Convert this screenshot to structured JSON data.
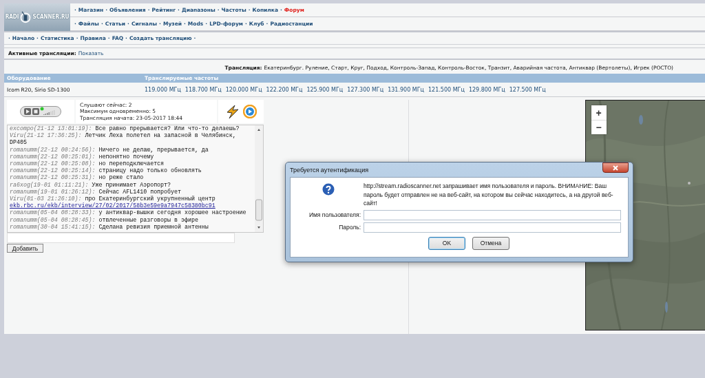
{
  "logo": {
    "left": "RADI",
    "right": "SCANNER.RU"
  },
  "separator": "·",
  "menu_rows": [
    [
      {
        "label": "Магазин",
        "color": "#1f4e79"
      },
      {
        "label": "Объявления",
        "color": "#1f4e79"
      },
      {
        "label": "Рейтинг",
        "color": "#1f4e79"
      },
      {
        "label": "Диапазоны",
        "color": "#1f4e79"
      },
      {
        "label": "Частоты",
        "color": "#1f4e79"
      },
      {
        "label": "Копилка",
        "color": "#1f4e79"
      },
      {
        "label": "Форум",
        "color": "#e0201b"
      }
    ],
    [
      {
        "label": "Файлы",
        "color": "#1f4e79"
      },
      {
        "label": "Статьи",
        "color": "#1f4e79"
      },
      {
        "label": "Сигналы",
        "color": "#1f4e79"
      },
      {
        "label": "Музей",
        "color": "#1f4e79"
      },
      {
        "label": "Mods",
        "color": "#1f4e79"
      },
      {
        "label": "LPD-форум",
        "color": "#1f4e79"
      },
      {
        "label": "Клуб",
        "color": "#1f4e79"
      },
      {
        "label": "Радиостанции",
        "color": "#1f4e79"
      }
    ]
  ],
  "sub_nav": [
    "Начало",
    "Статистика",
    "Правила",
    "FAQ",
    "Создать трансляцию"
  ],
  "active_streams": {
    "label": "Активные трансляции:",
    "link": "Показать"
  },
  "stream": {
    "label": "Трансляция:",
    "value": "Екатеринбург. Руление, Старт, Круг, Подход, Контроль-Запад, Контроль-Восток, Транзит, Аварийная частота, Антиквар (Вертолеты), Игрек (РОСТО)"
  },
  "table": {
    "columns": [
      "Оборудование",
      "Транслируемые частоты"
    ],
    "rows": [
      {
        "equipment": "Icom R20, Sirio SD-1300",
        "frequencies": [
          "119.000 МГц",
          "118.700 МГц",
          "120.000 МГц",
          "122.200 МГц",
          "125.900 МГц",
          "127.300 МГц",
          "131.900 МГц",
          "121.500 МГц",
          "129.800 МГц",
          "127.500 МГц"
        ]
      }
    ]
  },
  "stats": [
    "Слушают сейчас: 2",
    "Максимум одновременно: 5",
    "Трансляция начата: 23-05-2017 18:44"
  ],
  "chat": {
    "messages": [
      {
        "author": "excompo(21-12 13:01:19):",
        "text": "Все равно прерывается? Или что-то делаешь?"
      },
      {
        "author": "Viru(21-12 17:36:25):",
        "text": "Летчик Леха полетел на запасной в Челябинск, DP405"
      },
      {
        "author": "romanumm(22-12 00:24:56):",
        "text": "Ничего не делаю, прерывается, да"
      },
      {
        "author": "romanumm(22-12 00:25:01):",
        "text": "непонятно почему"
      },
      {
        "author": "romanumm(22-12 00:25:08):",
        "text": "но переподключается"
      },
      {
        "author": "romanumm(22-12 00:25:14):",
        "text": "страницу надо только обновлять"
      },
      {
        "author": "romanumm(22-12 00:25:31):",
        "text": "но реже стало"
      },
      {
        "author": "ra6xog(19-01 01:11:21):",
        "text": "Уже принимает Аэропорт?"
      },
      {
        "author": "romanumm(19-01 01:26:12):",
        "text": "Сейчас AFL1410 попробует"
      },
      {
        "author": "Viru(01-03 21:26:10):",
        "text": "про Екатеринбургский укрупненный центр",
        "link": "ekb.rbc.ru/ekb/interview/27/02/2017/58b3e59e9a7947c58380bc91"
      },
      {
        "author": "romanumm(05-04 08:28:33):",
        "text": "у антиквар-вышки сегодня хорошее настроение"
      },
      {
        "author": "romanumm(05-04 08:28:45):",
        "text": "отвлеченные разговоры в эфире"
      },
      {
        "author": "romanumm(30-04 15:41:15):",
        "text": "Сделана ревизия приемной антенны"
      }
    ],
    "add_button": "Добавить"
  },
  "map": {
    "zoom_in": "+",
    "zoom_out": "−"
  },
  "dialog": {
    "title": "Требуется аутентификация",
    "message": "http://stream.radioscanner.net запрашивает имя пользователя и пароль. ВНИМАНИЕ: Ваш пароль будет отправлен не на веб-сайт, на котором вы сейчас находитесь, а на другой веб-сайт!",
    "fields": [
      {
        "label": "Имя пользователя:"
      },
      {
        "label": "Пароль:"
      }
    ],
    "buttons": [
      {
        "label": "OK",
        "default": true
      },
      {
        "label": "Отмена",
        "default": false
      }
    ]
  }
}
